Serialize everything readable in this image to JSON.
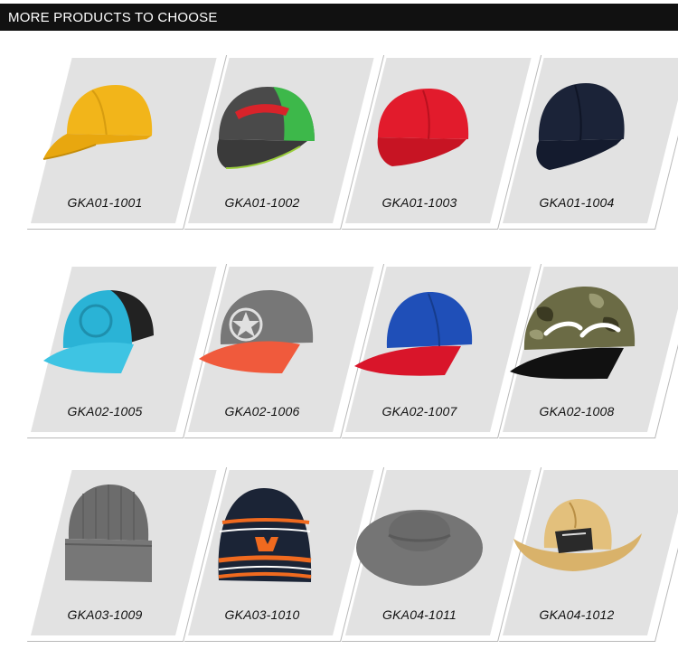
{
  "header": {
    "title": "MORE PRODUCTS TO CHOOSE"
  },
  "products": [
    {
      "code": "GKA01-1001",
      "icon": "yellow-baseball-cap-icon",
      "color": "#f2b51a"
    },
    {
      "code": "GKA01-1002",
      "icon": "grey-green-trucker-cap-icon",
      "color": "#4a4a4a"
    },
    {
      "code": "GKA01-1003",
      "icon": "red-baseball-cap-icon",
      "color": "#e21b2c"
    },
    {
      "code": "GKA01-1004",
      "icon": "navy-baseball-cap-icon",
      "color": "#1b2338"
    },
    {
      "code": "GKA02-1005",
      "icon": "blue-trucker-snapback-icon",
      "color": "#2ab3d6"
    },
    {
      "code": "GKA02-1006",
      "icon": "grey-orange-star-snapback-icon",
      "color": "#777777"
    },
    {
      "code": "GKA02-1007",
      "icon": "blue-red-snapback-icon",
      "color": "#1f4fb8"
    },
    {
      "code": "GKA02-1008",
      "icon": "camo-cali-snapback-icon",
      "color": "#5a5a3a"
    },
    {
      "code": "GKA03-1009",
      "icon": "grey-beanie-icon",
      "color": "#6c6c6c"
    },
    {
      "code": "GKA03-1010",
      "icon": "striped-beanie-icon",
      "color": "#1b2436"
    },
    {
      "code": "GKA04-1011",
      "icon": "grey-sun-hat-icon",
      "color": "#757575"
    },
    {
      "code": "GKA04-1012",
      "icon": "straw-cowboy-hat-icon",
      "color": "#d9b26a"
    }
  ]
}
